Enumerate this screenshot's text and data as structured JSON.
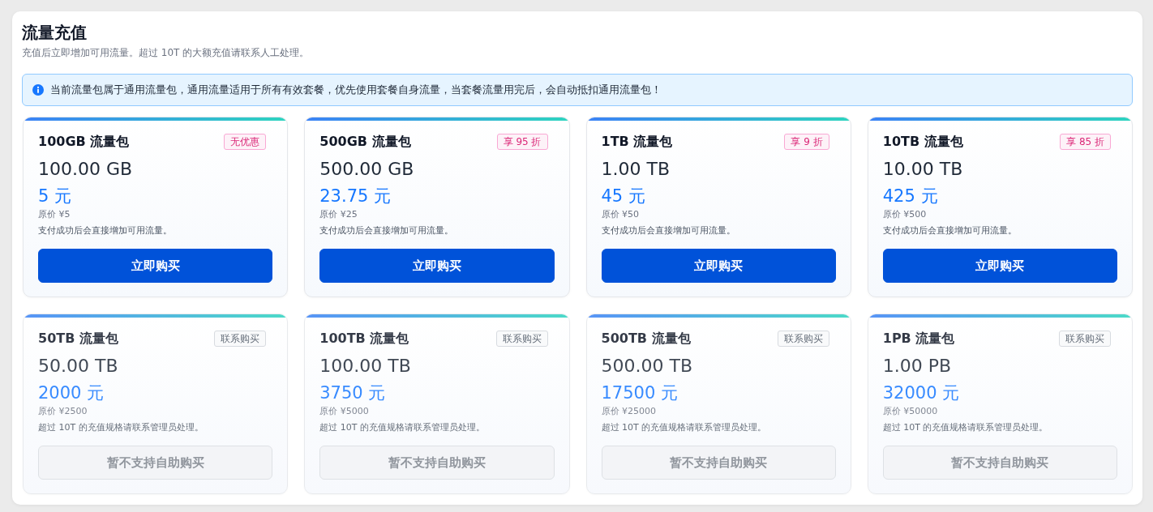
{
  "page": {
    "title": "流量充值",
    "subtitle": "充值后立即增加可用流量。超过 10T 的大额充值请联系人工处理。"
  },
  "notice": {
    "text": "当前流量包属于通用流量包，通用流量适用于所有有效套餐，优先使用套餐自身流量，当套餐流量用完后，会自动抵扣通用流量包！"
  },
  "packages": [
    {
      "name": "100GB 流量包",
      "disabled": false,
      "badge": {
        "kind": "discount",
        "text": "无优惠"
      },
      "size": "100.00 GB",
      "price": "5 元",
      "original_price": "原价 ¥5",
      "note": "支付成功后会直接增加可用流量。",
      "button": "立即购买"
    },
    {
      "name": "500GB 流量包",
      "disabled": false,
      "badge": {
        "kind": "discount",
        "text": "享 95 折"
      },
      "size": "500.00 GB",
      "price": "23.75 元",
      "original_price": "原价 ¥25",
      "note": "支付成功后会直接增加可用流量。",
      "button": "立即购买"
    },
    {
      "name": "1TB 流量包",
      "disabled": false,
      "badge": {
        "kind": "discount",
        "text": "享 9 折"
      },
      "size": "1.00 TB",
      "price": "45 元",
      "original_price": "原价 ¥50",
      "note": "支付成功后会直接增加可用流量。",
      "button": "立即购买"
    },
    {
      "name": "10TB 流量包",
      "disabled": false,
      "badge": {
        "kind": "discount",
        "text": "享 85 折"
      },
      "size": "10.00 TB",
      "price": "425 元",
      "original_price": "原价 ¥500",
      "note": "支付成功后会直接增加可用流量。",
      "button": "立即购买"
    },
    {
      "name": "50TB 流量包",
      "disabled": true,
      "badge": {
        "kind": "contact",
        "text": "联系购买"
      },
      "size": "50.00 TB",
      "price": "2000 元",
      "original_price": "原价 ¥2500",
      "note": "超过 10T 的充值规格请联系管理员处理。",
      "button": "暂不支持自助购买"
    },
    {
      "name": "100TB 流量包",
      "disabled": true,
      "badge": {
        "kind": "contact",
        "text": "联系购买"
      },
      "size": "100.00 TB",
      "price": "3750 元",
      "original_price": "原价 ¥5000",
      "note": "超过 10T 的充值规格请联系管理员处理。",
      "button": "暂不支持自助购买"
    },
    {
      "name": "500TB 流量包",
      "disabled": true,
      "badge": {
        "kind": "contact",
        "text": "联系购买"
      },
      "size": "500.00 TB",
      "price": "17500 元",
      "original_price": "原价 ¥25000",
      "note": "超过 10T 的充值规格请联系管理员处理。",
      "button": "暂不支持自助购买"
    },
    {
      "name": "1PB 流量包",
      "disabled": true,
      "badge": {
        "kind": "contact",
        "text": "联系购买"
      },
      "size": "1.00 PB",
      "price": "32000 元",
      "original_price": "原价 ¥50000",
      "note": "超过 10T 的充值规格请联系管理员处理。",
      "button": "暂不支持自助购买"
    }
  ]
}
